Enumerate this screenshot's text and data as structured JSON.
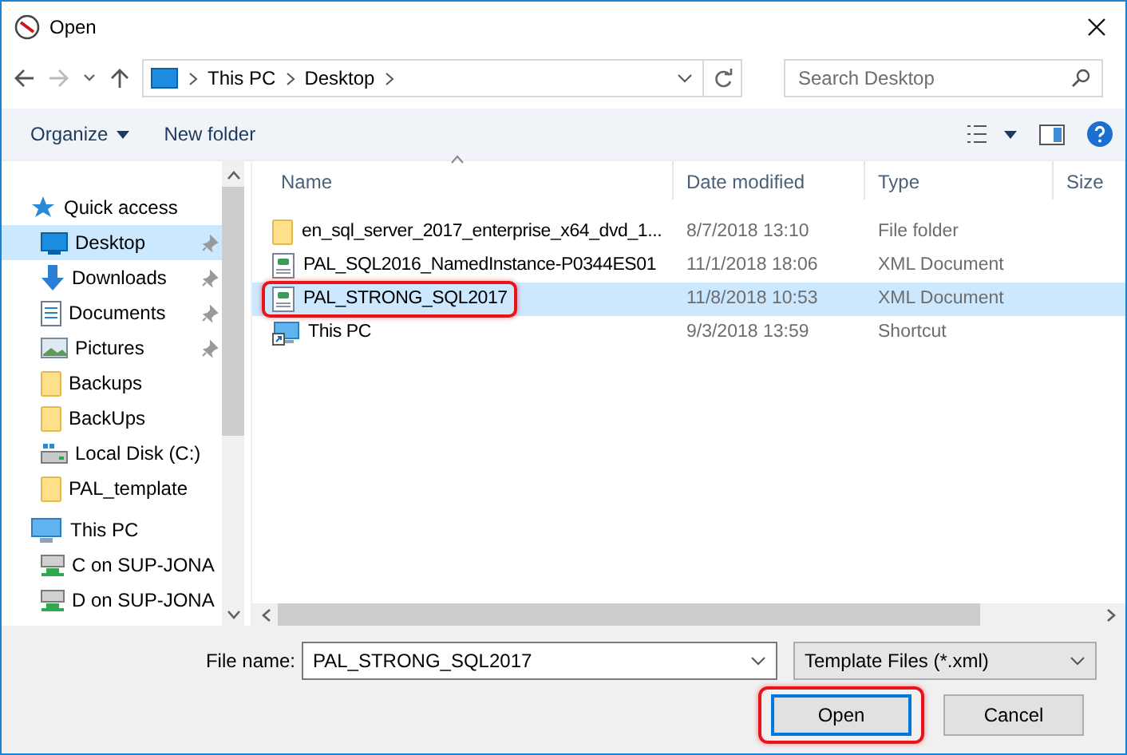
{
  "window": {
    "title": "Open"
  },
  "address": {
    "segments": [
      "This PC",
      "Desktop"
    ]
  },
  "search": {
    "placeholder": "Search Desktop"
  },
  "toolbar": {
    "buttons": [
      {
        "label": "Organize",
        "dropdown": true
      },
      {
        "label": "New folder",
        "dropdown": false
      }
    ]
  },
  "sidebar": {
    "items": [
      {
        "label": "Quick access",
        "kind": "star",
        "selected": false,
        "children": [
          {
            "label": "Desktop",
            "kind": "desktop",
            "selected": true,
            "pinned": true
          },
          {
            "label": "Downloads",
            "kind": "download",
            "selected": false,
            "pinned": true
          },
          {
            "label": "Documents",
            "kind": "document",
            "selected": false,
            "pinned": true
          },
          {
            "label": "Pictures",
            "kind": "picture",
            "selected": false,
            "pinned": true
          },
          {
            "label": "Backups",
            "kind": "folder",
            "selected": false,
            "pinned": false
          },
          {
            "label": "BackUps",
            "kind": "folder",
            "selected": false,
            "pinned": false
          },
          {
            "label": "Local Disk (C:)",
            "kind": "disk",
            "selected": false,
            "pinned": false
          },
          {
            "label": "PAL_template",
            "kind": "folder",
            "selected": false,
            "pinned": false
          }
        ]
      },
      {
        "label": "This PC",
        "kind": "pc",
        "selected": false,
        "children": [
          {
            "label": "C on SUP-JONA",
            "kind": "netdrive",
            "selected": false,
            "pinned": false
          },
          {
            "label": "D on SUP-JONA",
            "kind": "netdrive",
            "selected": false,
            "pinned": false
          }
        ]
      }
    ]
  },
  "file_list": {
    "columns": [
      "Name",
      "Date modified",
      "Type",
      "Size"
    ],
    "rows": [
      {
        "name": "en_sql_server_2017_enterprise_x64_dvd_1...",
        "date": "8/7/2018 13:10",
        "type": "File folder",
        "kind": "folder",
        "selected": false,
        "highlighted": false
      },
      {
        "name": "PAL_SQL2016_NamedInstance-P0344ES01",
        "date": "11/1/2018 18:06",
        "type": "XML Document",
        "kind": "xml",
        "selected": false,
        "highlighted": false
      },
      {
        "name": "PAL_STRONG_SQL2017",
        "date": "11/8/2018 10:53",
        "type": "XML Document",
        "kind": "xml",
        "selected": true,
        "highlighted": true
      },
      {
        "name": "This PC",
        "date": "9/3/2018 13:59",
        "type": "Shortcut",
        "kind": "shortcut",
        "selected": false,
        "highlighted": false
      }
    ]
  },
  "footer": {
    "file_name_label": "File name:",
    "file_name": "PAL_STRONG_SQL2017",
    "file_type": "Template Files (*.xml)",
    "buttons": [
      {
        "label": "Open",
        "default": true,
        "highlighted": true
      },
      {
        "label": "Cancel",
        "default": false,
        "highlighted": false
      }
    ]
  }
}
